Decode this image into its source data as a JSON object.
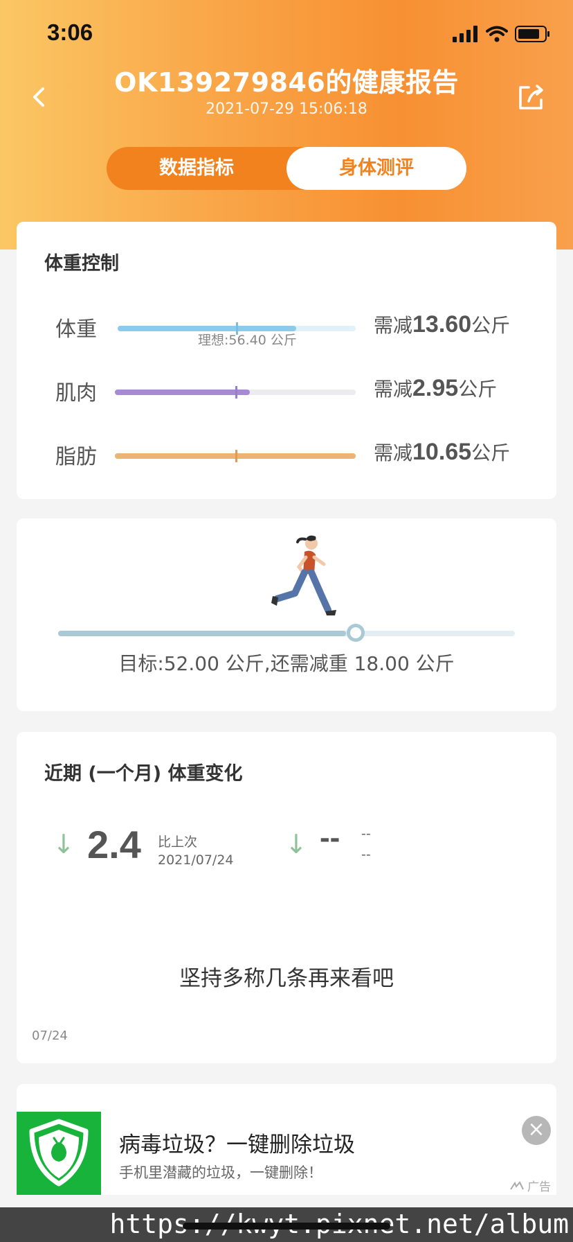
{
  "status_bar": {
    "time": "3:06"
  },
  "header": {
    "title": "OK139279846的健康报告",
    "subtitle": "2021-07-29 15:06:18",
    "tabs": [
      {
        "label": "数据指标",
        "active": false
      },
      {
        "label": "身体测评",
        "active": true
      }
    ],
    "accent_color": "#f2821e"
  },
  "weight_control": {
    "title": "体重控制",
    "ideal_label": "理想:56.40 公斤",
    "metrics": [
      {
        "name": "体重",
        "need_prefix": "需减",
        "value": "13.60",
        "unit": "公斤",
        "fill_fraction": 0.75,
        "ideal_fraction": 0.5,
        "color": "#8ecbea"
      },
      {
        "name": "肌肉",
        "need_prefix": "需减",
        "value": "2.95",
        "unit": "公斤",
        "fill_fraction": 0.56,
        "ideal_fraction": 0.5,
        "color": "#a68ad6"
      },
      {
        "name": "脂肪",
        "need_prefix": "需减",
        "value": "10.65",
        "unit": "公斤",
        "fill_fraction": 1.0,
        "ideal_fraction": 0.5,
        "color": "#e9b474"
      }
    ]
  },
  "goal": {
    "progress_fraction": 0.63,
    "text": "目标:52.00 公斤,还需减重 18.00 公斤"
  },
  "trend": {
    "title": "近期 (一个月) 体重变化",
    "primary": {
      "arrow": "↓",
      "value": "2.4",
      "label": "比上次",
      "date": "2021/07/24"
    },
    "secondary": {
      "arrow": "↓",
      "value": "--",
      "label": "--",
      "date": "--"
    },
    "empty_message": "坚持多称几条再来看吧",
    "axis_date": "07/24"
  },
  "ad": {
    "title": "病毒垃圾？一键删除垃圾",
    "description": "手机里潜藏的垃圾，一键删除！",
    "badge": "广告",
    "close": "×"
  },
  "watermark": "https://kwyt.pixnet.net/album"
}
